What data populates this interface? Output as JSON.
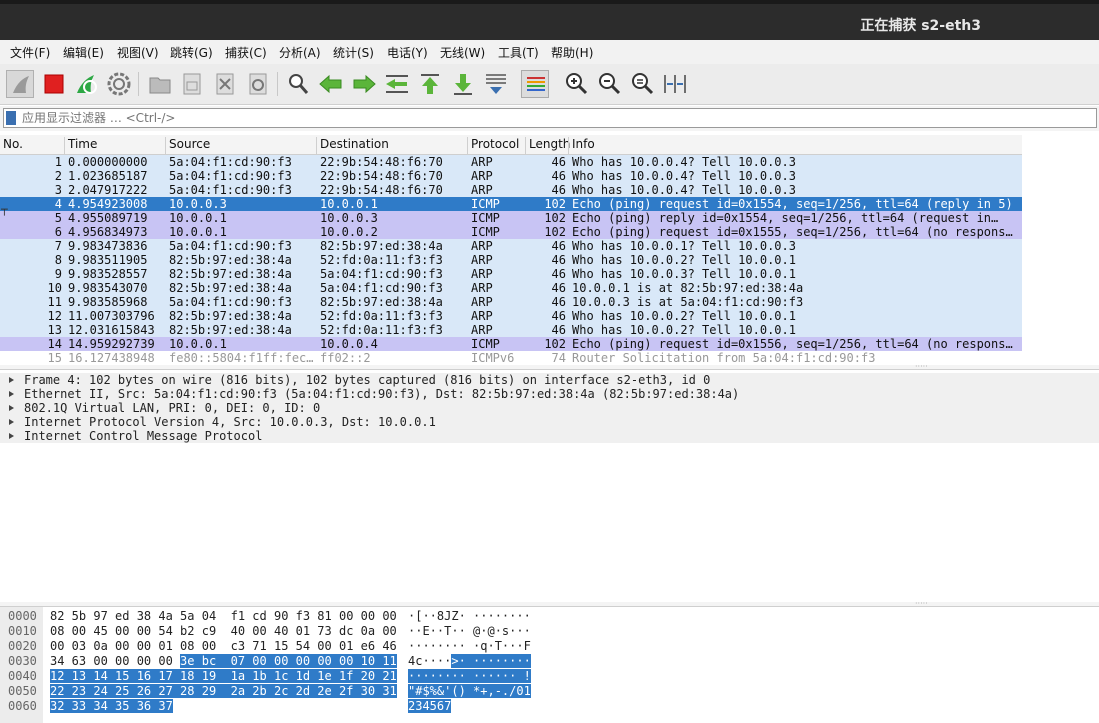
{
  "window": {
    "title": "正在捕获 s2-eth3"
  },
  "menu": [
    "文件(F)",
    "编辑(E)",
    "视图(V)",
    "跳转(G)",
    "捕获(C)",
    "分析(A)",
    "统计(S)",
    "电话(Y)",
    "无线(W)",
    "工具(T)",
    "帮助(H)"
  ],
  "toolbar": {
    "icons": [
      "shark-fin-start-icon",
      "stop-icon",
      "restart-icon",
      "capture-options-icon",
      "open-file-icon",
      "save-file-icon",
      "close-file-icon",
      "reload-icon",
      "find-icon",
      "go-back-icon",
      "go-forward-icon",
      "go-to-packet-icon",
      "first-packet-icon",
      "last-packet-icon",
      "autoscroll-icon",
      "colorize-icon",
      "zoom-in-icon",
      "zoom-out-icon",
      "normal-size-icon",
      "resize-columns-icon"
    ]
  },
  "filter": {
    "placeholder": "应用显示过滤器 … <Ctrl-/>"
  },
  "packet_list": {
    "columns": [
      "No.",
      "Time",
      "Source",
      "Destination",
      "Protocol",
      "Length",
      "Info"
    ],
    "rows": [
      {
        "no": "1",
        "time": "0.000000000",
        "src": "5a:04:f1:cd:90:f3",
        "dst": "22:9b:54:48:f6:70",
        "proto": "ARP",
        "len": "46",
        "info": "Who has 10.0.0.4? Tell 10.0.0.3",
        "style": "arp"
      },
      {
        "no": "2",
        "time": "1.023685187",
        "src": "5a:04:f1:cd:90:f3",
        "dst": "22:9b:54:48:f6:70",
        "proto": "ARP",
        "len": "46",
        "info": "Who has 10.0.0.4? Tell 10.0.0.3",
        "style": "arp"
      },
      {
        "no": "3",
        "time": "2.047917222",
        "src": "5a:04:f1:cd:90:f3",
        "dst": "22:9b:54:48:f6:70",
        "proto": "ARP",
        "len": "46",
        "info": "Who has 10.0.0.4? Tell 10.0.0.3",
        "style": "arp"
      },
      {
        "no": "4",
        "time": "4.954923008",
        "src": "10.0.0.3",
        "dst": "10.0.0.1",
        "proto": "ICMP",
        "len": "102",
        "info": "Echo (ping) request  id=0x1554, seq=1/256, ttl=64 (reply in 5)",
        "style": "sel"
      },
      {
        "no": "5",
        "time": "4.955089719",
        "src": "10.0.0.1",
        "dst": "10.0.0.3",
        "proto": "ICMP",
        "len": "102",
        "info": "Echo (ping) reply    id=0x1554, seq=1/256, ttl=64 (request in…",
        "style": "icmp"
      },
      {
        "no": "6",
        "time": "4.956834973",
        "src": "10.0.0.1",
        "dst": "10.0.0.2",
        "proto": "ICMP",
        "len": "102",
        "info": "Echo (ping) request  id=0x1555, seq=1/256, ttl=64 (no respons…",
        "style": "icmp"
      },
      {
        "no": "7",
        "time": "9.983473836",
        "src": "5a:04:f1:cd:90:f3",
        "dst": "82:5b:97:ed:38:4a",
        "proto": "ARP",
        "len": "46",
        "info": "Who has 10.0.0.1? Tell 10.0.0.3",
        "style": "arp"
      },
      {
        "no": "8",
        "time": "9.983511905",
        "src": "82:5b:97:ed:38:4a",
        "dst": "52:fd:0a:11:f3:f3",
        "proto": "ARP",
        "len": "46",
        "info": "Who has 10.0.0.2? Tell 10.0.0.1",
        "style": "arp"
      },
      {
        "no": "9",
        "time": "9.983528557",
        "src": "82:5b:97:ed:38:4a",
        "dst": "5a:04:f1:cd:90:f3",
        "proto": "ARP",
        "len": "46",
        "info": "Who has 10.0.0.3? Tell 10.0.0.1",
        "style": "arp"
      },
      {
        "no": "10",
        "time": "9.983543070",
        "src": "82:5b:97:ed:38:4a",
        "dst": "5a:04:f1:cd:90:f3",
        "proto": "ARP",
        "len": "46",
        "info": "10.0.0.1 is at 82:5b:97:ed:38:4a",
        "style": "arp"
      },
      {
        "no": "11",
        "time": "9.983585968",
        "src": "5a:04:f1:cd:90:f3",
        "dst": "82:5b:97:ed:38:4a",
        "proto": "ARP",
        "len": "46",
        "info": "10.0.0.3 is at 5a:04:f1:cd:90:f3",
        "style": "arp"
      },
      {
        "no": "12",
        "time": "11.007303796",
        "src": "82:5b:97:ed:38:4a",
        "dst": "52:fd:0a:11:f3:f3",
        "proto": "ARP",
        "len": "46",
        "info": "Who has 10.0.0.2? Tell 10.0.0.1",
        "style": "arp"
      },
      {
        "no": "13",
        "time": "12.031615843",
        "src": "82:5b:97:ed:38:4a",
        "dst": "52:fd:0a:11:f3:f3",
        "proto": "ARP",
        "len": "46",
        "info": "Who has 10.0.0.2? Tell 10.0.0.1",
        "style": "arp"
      },
      {
        "no": "14",
        "time": "14.959292739",
        "src": "10.0.0.1",
        "dst": "10.0.0.4",
        "proto": "ICMP",
        "len": "102",
        "info": "Echo (ping) request  id=0x1556, seq=1/256, ttl=64 (no respons…",
        "style": "icmp"
      },
      {
        "no": "15",
        "time": "16.127438948",
        "src": "fe80::5804:f1ff:fec…",
        "dst": "ff02::2",
        "proto": "ICMPv6",
        "len": "74",
        "info": "Router Solicitation from 5a:04:f1:cd:90:f3",
        "style": "icmpv6"
      }
    ]
  },
  "details": [
    "Frame 4: 102 bytes on wire (816 bits), 102 bytes captured (816 bits) on interface s2-eth3, id 0",
    "Ethernet II, Src: 5a:04:f1:cd:90:f3 (5a:04:f1:cd:90:f3), Dst: 82:5b:97:ed:38:4a (82:5b:97:ed:38:4a)",
    "802.1Q Virtual LAN, PRI: 0, DEI: 0, ID: 0",
    "Internet Protocol Version 4, Src: 10.0.0.3, Dst: 10.0.0.1",
    "Internet Control Message Protocol"
  ],
  "hex": [
    {
      "off": "0000",
      "hex_pre": "82 5b 97 ed 38 4a 5a 04  f1 cd 90 f3 81 00 00 00",
      "hex_sel": "",
      "ascii_pre": "·[··8JZ· ········",
      "ascii_sel": ""
    },
    {
      "off": "0010",
      "hex_pre": "08 00 45 00 00 54 b2 c9  40 00 40 01 73 dc 0a 00",
      "hex_sel": "",
      "ascii_pre": "··E··T·· @·@·s···",
      "ascii_sel": ""
    },
    {
      "off": "0020",
      "hex_pre": "00 03 0a 00 00 01 08 00  c3 71 15 54 00 01 e6 46",
      "hex_sel": "",
      "ascii_pre": "········ ·q·T···F",
      "ascii_sel": ""
    },
    {
      "off": "0030",
      "hex_pre": "34 63 00 00 00 00 ",
      "hex_sel": "3e bc  07 00 00 00 00 00 10 11",
      "ascii_pre": "4c····",
      "ascii_sel": ">· ········"
    },
    {
      "off": "0040",
      "hex_pre": "",
      "hex_sel": "12 13 14 15 16 17 18 19  1a 1b 1c 1d 1e 1f 20 21",
      "ascii_pre": "",
      "ascii_sel": "········ ······ !"
    },
    {
      "off": "0050",
      "hex_pre": "",
      "hex_sel": "22 23 24 25 26 27 28 29  2a 2b 2c 2d 2e 2f 30 31",
      "ascii_pre": "",
      "ascii_sel": "\"#$%&'() *+,-./01"
    },
    {
      "off": "0060",
      "hex_pre": "",
      "hex_sel": "32 33 34 35 36 37",
      "ascii_pre": "",
      "ascii_sel": "234567"
    }
  ]
}
